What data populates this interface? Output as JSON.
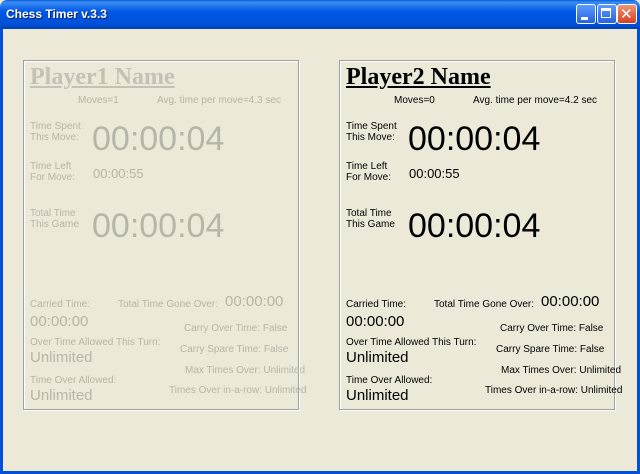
{
  "window": {
    "title": "Chess Timer v.3.3"
  },
  "players": [
    {
      "name": "Player1 Name",
      "moves": "Moves=1",
      "avg": "Avg. time per move=4.3 sec",
      "time_spent_label_1": "Time Spent",
      "time_spent_label_2": "This Move:",
      "time_spent": "00:00:04",
      "time_left_label_1": "Time Left",
      "time_left_label_2": "For Move:",
      "time_left": "00:00:55",
      "total_label_1": "Total Time",
      "total_label_2": "This Game",
      "total": "00:00:04",
      "carried_label": "Carried Time:",
      "carried": "00:00:00",
      "gone_over_label": "Total Time Gone Over:",
      "gone_over": "00:00:00",
      "over_allowed_turn_label": "Over Time Allowed This Turn:",
      "over_allowed_turn": "Unlimited",
      "time_over_allowed_label": "Time Over Allowed:",
      "time_over_allowed": "Unlimited",
      "carry_over": "Carry Over Time: False",
      "carry_spare": "Carry Spare Time: False",
      "max_times_over": "Max Times Over: Unlimited",
      "times_over_row": "Times Over in-a-row: Unlimited"
    },
    {
      "name": "Player2 Name",
      "moves": "Moves=0",
      "avg": "Avg. time per move=4.2 sec",
      "time_spent_label_1": "Time Spent",
      "time_spent_label_2": "This Move:",
      "time_spent": "00:00:04",
      "time_left_label_1": "Time Left",
      "time_left_label_2": "For Move:",
      "time_left": "00:00:55",
      "total_label_1": "Total Time",
      "total_label_2": "This Game",
      "total": "00:00:04",
      "carried_label": "Carried Time:",
      "carried": "00:00:00",
      "gone_over_label": "Total Time Gone Over:",
      "gone_over": "00:00:00",
      "over_allowed_turn_label": "Over Time Allowed This Turn:",
      "over_allowed_turn": "Unlimited",
      "time_over_allowed_label": "Time Over Allowed:",
      "time_over_allowed": "Unlimited",
      "carry_over": "Carry Over Time: False",
      "carry_spare": "Carry Spare Time: False",
      "max_times_over": "Max Times Over: Unlimited",
      "times_over_row": "Times Over in-a-row: Unlimited"
    }
  ]
}
